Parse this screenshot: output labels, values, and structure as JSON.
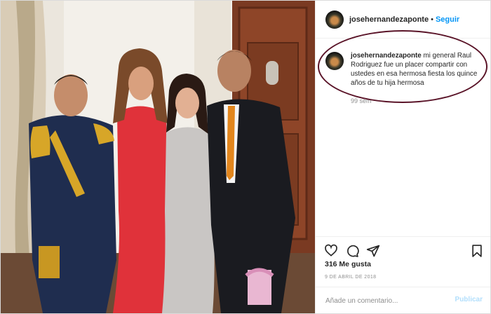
{
  "post": {
    "username": "josehernandezaponte",
    "separator": "•",
    "follow_label": "Seguir"
  },
  "comment": {
    "username": "josehernandezaponte",
    "text": "mi general Raul Rodriguez fue un placer compartir con ustedes en esa hermosa fiesta los quince años de tu hija hermosa",
    "time": "99 sem"
  },
  "actions": {
    "likes": "316 Me gusta",
    "date": "9 DE ABRIL DE 2018",
    "icons": [
      "heart-icon",
      "comment-icon",
      "share-icon",
      "bookmark-icon"
    ]
  },
  "add_comment": {
    "placeholder": "Añade un comentario...",
    "publish_label": "Publicar"
  },
  "colors": {
    "accent": "#0095f6",
    "highlight_ring": "#5a1428",
    "publish_disabled": "#b2dffc"
  }
}
